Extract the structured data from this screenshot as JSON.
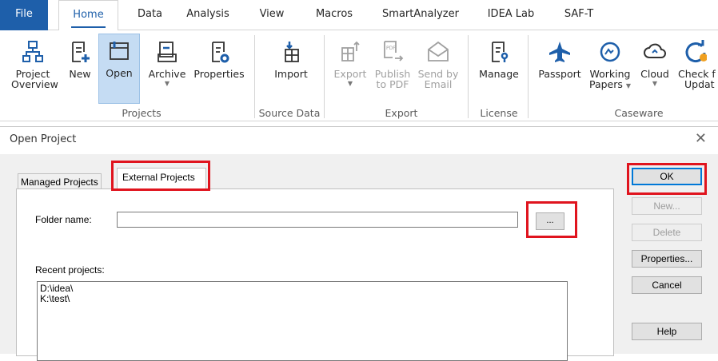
{
  "ribbon": {
    "tabs": [
      "File",
      "Home",
      "Data",
      "Analysis",
      "View",
      "Macros",
      "SmartAnalyzer",
      "IDEA Lab",
      "SAF-T"
    ],
    "groups": {
      "projects": "Projects",
      "source_data": "Source Data",
      "export": "Export",
      "license": "License",
      "caseware": "Caseware"
    },
    "buttons": {
      "project_overview": [
        "Project",
        "Overview"
      ],
      "new": "New",
      "open": "Open",
      "archive": "Archive",
      "properties": "Properties",
      "import": "Import",
      "export": "Export",
      "publish_pdf": [
        "Publish",
        "to PDF"
      ],
      "send_email": [
        "Send by",
        "Email"
      ],
      "manage": "Manage",
      "passport": "Passport",
      "working_papers": [
        "Working",
        "Papers"
      ],
      "cloud": "Cloud",
      "check_updates": [
        "Check f",
        "Updat"
      ]
    }
  },
  "dialog": {
    "title": "Open Project",
    "close": "✕",
    "tabs": {
      "managed": "Managed Projects",
      "external": "External Projects"
    },
    "folder_label": "Folder name:",
    "folder_value": "",
    "browse": "...",
    "recent_label": "Recent projects:",
    "recent": [
      "D:\\idea\\",
      "K:\\test\\"
    ],
    "buttons": {
      "ok": "OK",
      "new": "New...",
      "delete": "Delete",
      "properties": "Properties...",
      "cancel": "Cancel",
      "help": "Help"
    }
  },
  "colors": {
    "accent": "#1e5faa",
    "highlight": "#e0141e",
    "active_bg": "#c5dcf3"
  }
}
